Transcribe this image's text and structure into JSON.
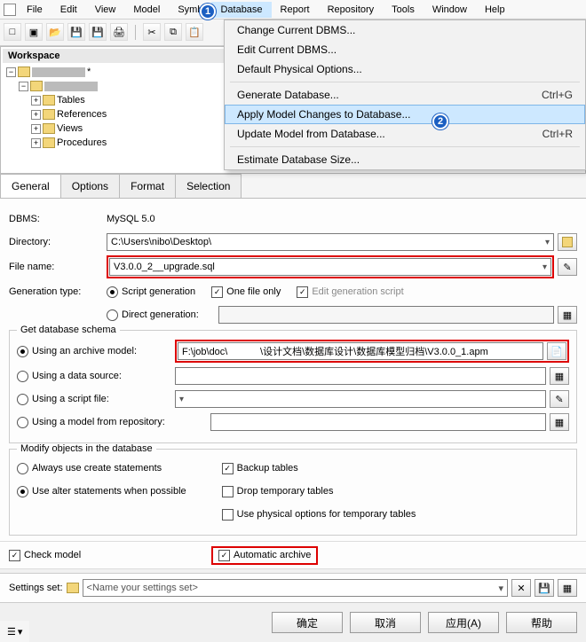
{
  "menu": [
    "File",
    "Edit",
    "View",
    "Model",
    "Symb",
    "Database",
    "Report",
    "Repository",
    "Tools",
    "Window",
    "Help"
  ],
  "menu_hl_index": 5,
  "dropdown": {
    "groups": [
      [
        "Change Current DBMS...",
        "Edit Current DBMS...",
        "Default Physical Options..."
      ],
      [
        {
          "label": "Generate Database...",
          "shortcut": "Ctrl+G"
        },
        {
          "label": "Apply Model Changes to Database...",
          "hl": true
        },
        {
          "label": "Update Model from Database...",
          "shortcut": "Ctrl+R"
        }
      ],
      [
        "Estimate Database Size..."
      ]
    ]
  },
  "callouts": {
    "c1": "1",
    "c2": "2"
  },
  "workspace": {
    "title": "Workspace",
    "root_masked": true,
    "children": [
      "Tables",
      "References",
      "Views",
      "Procedures"
    ]
  },
  "tabs": [
    "General",
    "Options",
    "Format",
    "Selection"
  ],
  "active_tab": 0,
  "general": {
    "dbms_label": "DBMS:",
    "dbms_value": "MySQL 5.0",
    "directory_label": "Directory:",
    "directory_value": "C:\\Users\\nibo\\Desktop\\",
    "filename_label": "File name:",
    "filename_value": "V3.0.0_2__upgrade.sql",
    "gentype_label": "Generation type:",
    "script_generation": "Script generation",
    "one_file_only": "One file only",
    "edit_gen_script": "Edit generation script",
    "direct_generation": "Direct generation:"
  },
  "schema_group": {
    "legend": "Get database schema",
    "archive_model": "Using an archive model:",
    "archive_path": "F:\\job\\doc\\            \\设计文档\\数据库设计\\数据库模型归档\\V3.0.0_1.apm",
    "data_source": "Using a data source:",
    "script_file": "Using a script file:",
    "repo_model": "Using a model from repository:"
  },
  "modify_group": {
    "legend": "Modify objects in the database",
    "always_create": "Always use create statements",
    "use_alter": "Use alter statements when possible",
    "backup": "Backup tables",
    "drop_temp": "Drop temporary tables",
    "physical_temp": "Use physical options for temporary tables"
  },
  "check_model": "Check model",
  "auto_archive": "Automatic archive",
  "settings_label": "Settings set:",
  "settings_placeholder": "<Name your settings set>",
  "buttons": {
    "ok": "确定",
    "cancel": "取消",
    "apply": "应用(A)",
    "help": "帮助"
  }
}
